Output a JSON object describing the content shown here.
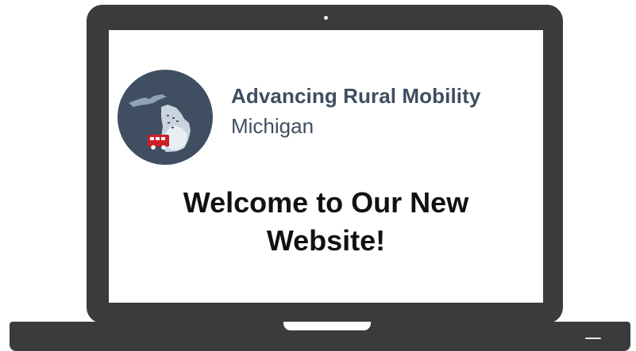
{
  "screen": {
    "brand": {
      "title": "Advancing Rural Mobility",
      "subtitle": "Michigan"
    },
    "headline": {
      "line1": "Welcome to Our New",
      "line2": "Website!"
    }
  },
  "colors": {
    "laptop_body": "#3b3b3d",
    "logo_circle": "#3f4e61",
    "brand_text": "#3f4e61",
    "headline_text": "#111111",
    "bus_red": "#cc1f27"
  },
  "icons": {
    "logo": "michigan-map-with-bus-logo",
    "camera": "webcam-dot"
  }
}
